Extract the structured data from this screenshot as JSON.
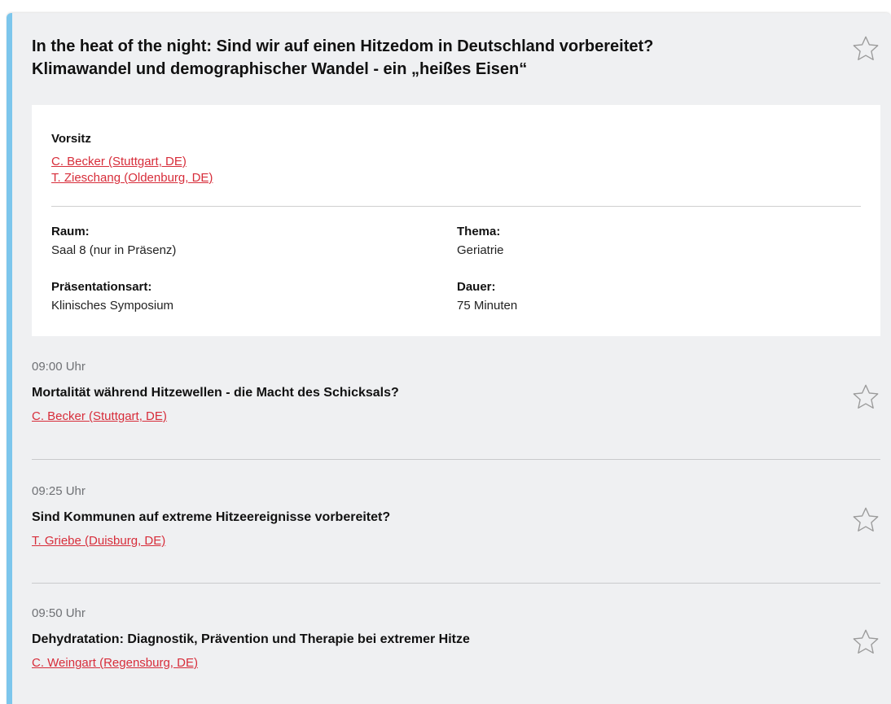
{
  "session": {
    "title_line1": "In the heat of the night: Sind wir auf einen Hitzedom in Deutschland vorbereitet?",
    "title_line2": "Klimawandel und demographischer Wandel - ein „heißes Eisen“",
    "favorite_icon": "star-outline-icon",
    "accent_color": "#7cc6ec",
    "link_color": "#d72d3a"
  },
  "info": {
    "vorsitz_label": "Vorsitz",
    "chairs": [
      "C. Becker (Stuttgart, DE)",
      "T. Zieschang (Oldenburg, DE)"
    ],
    "raum_label": "Raum:",
    "raum_value": "Saal 8 (nur in Präsenz)",
    "thema_label": "Thema:",
    "thema_value": "Geriatrie",
    "praesentationsart_label": "Präsentationsart:",
    "praesentationsart_value": "Klinisches Symposium",
    "dauer_label": "Dauer:",
    "dauer_value": "75 Minuten"
  },
  "talks": [
    {
      "time": "09:00 Uhr",
      "title": "Mortalität während Hitzewellen - die Macht des Schicksals?",
      "speaker": "C. Becker (Stuttgart, DE)"
    },
    {
      "time": "09:25 Uhr",
      "title": "Sind Kommunen auf extreme Hitzeereignisse vorbereitet?",
      "speaker": "T. Griebe (Duisburg, DE)"
    },
    {
      "time": "09:50 Uhr",
      "title": "Dehydratation: Diagnostik, Prävention und Therapie bei extremer Hitze",
      "speaker": "C. Weingart (Regensburg, DE)"
    }
  ]
}
